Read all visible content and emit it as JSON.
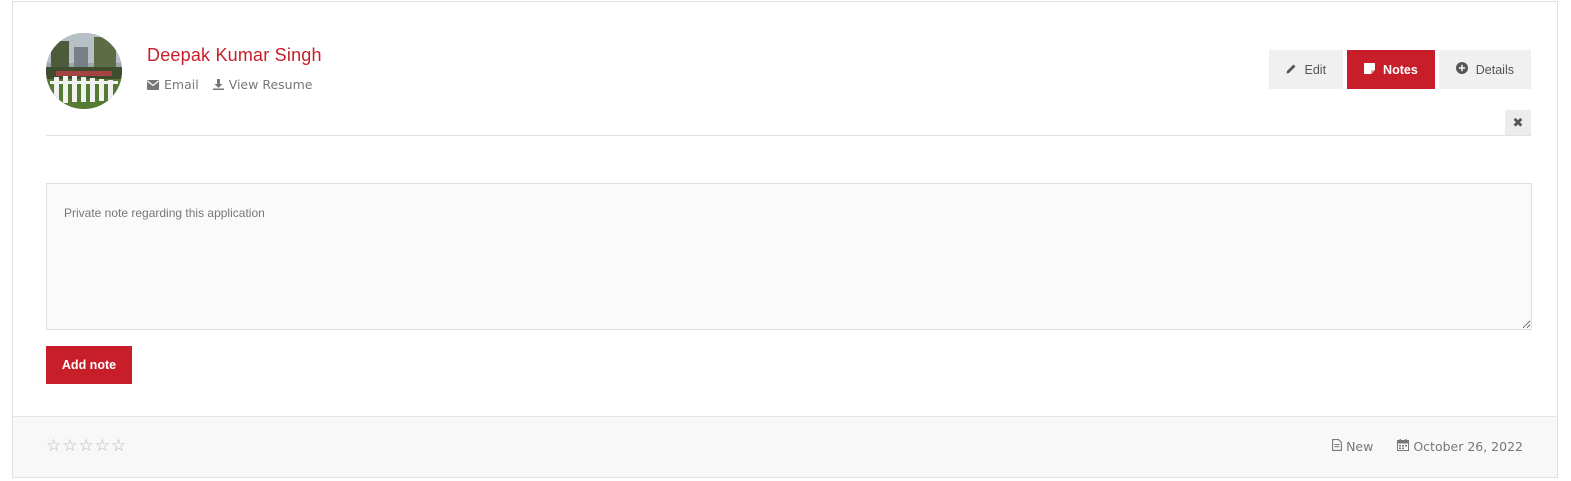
{
  "candidate": {
    "name": "Deepak Kumar Singh",
    "email_label": "Email",
    "resume_label": "View Resume"
  },
  "actions": {
    "edit_label": "Edit",
    "notes_label": "Notes",
    "details_label": "Details",
    "close_label": "✖"
  },
  "note_form": {
    "placeholder": "Private note regarding this application",
    "value": "",
    "submit_label": "Add note"
  },
  "footer": {
    "rating": 0,
    "stars": [
      "☆",
      "☆",
      "☆",
      "☆",
      "☆"
    ],
    "status": "New",
    "date": "October 26, 2022"
  },
  "colors": {
    "accent": "#c81e29",
    "button_bg": "#f0f0f0",
    "footer_bg": "#f8f8f8"
  },
  "icons": {
    "email": "envelope-icon",
    "resume": "download-icon",
    "edit": "pencil-icon",
    "notes": "sticky-note-icon",
    "details": "plus-circle-icon",
    "close": "close-icon",
    "status": "file-icon",
    "date": "calendar-icon"
  }
}
